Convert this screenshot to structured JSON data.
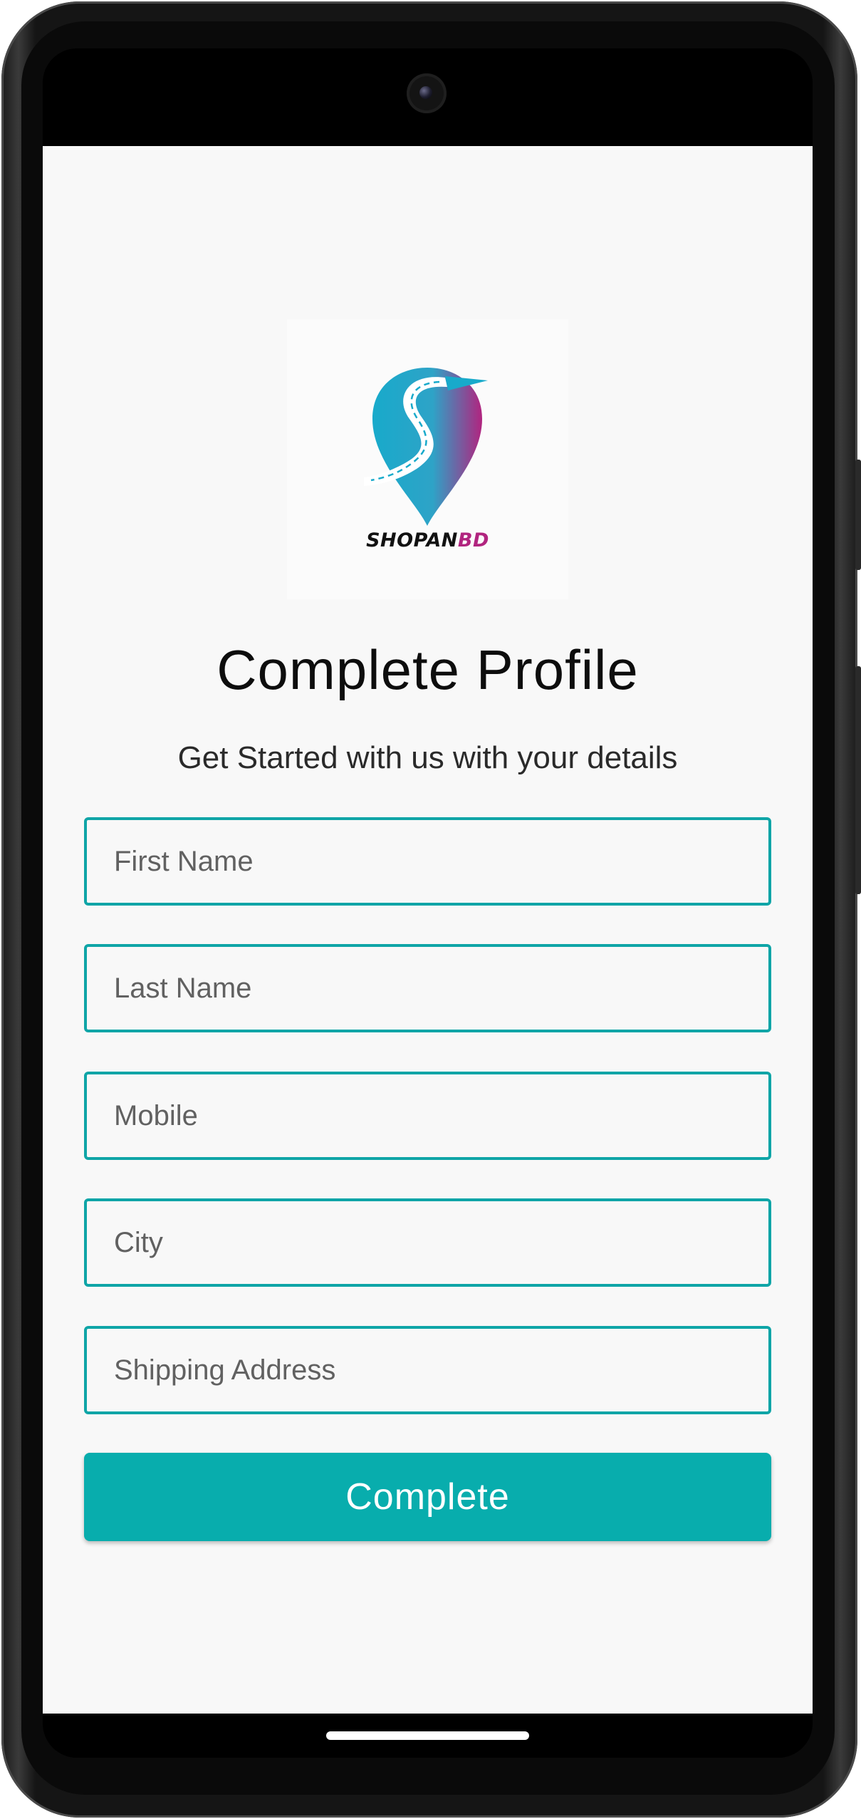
{
  "brand": {
    "logo_name": "SHOPAN",
    "logo_suffix": "BD",
    "colors": {
      "teal": "#0fa5a7",
      "magenta": "#b1247f"
    }
  },
  "page": {
    "title": "Complete Profile",
    "subtitle": "Get Started with us with your details"
  },
  "form": {
    "fields": [
      {
        "placeholder": "First Name",
        "value": ""
      },
      {
        "placeholder": "Last Name",
        "value": ""
      },
      {
        "placeholder": "Mobile",
        "value": ""
      },
      {
        "placeholder": "City",
        "value": ""
      },
      {
        "placeholder": "Shipping Address",
        "value": ""
      }
    ],
    "submit_label": "Complete"
  },
  "theme": {
    "accent": "#08adad",
    "background": "#f8f8f8"
  }
}
